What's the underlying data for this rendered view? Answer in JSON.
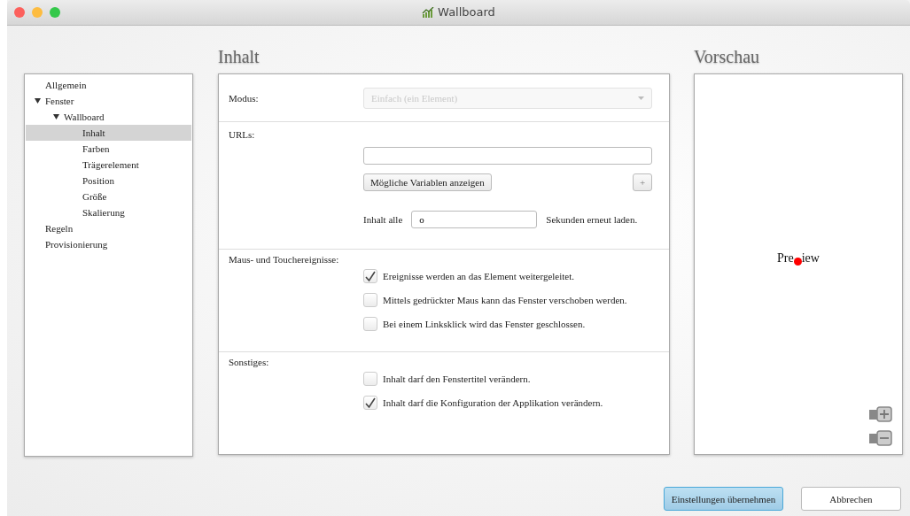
{
  "window": {
    "title": "Wallboard"
  },
  "headings": {
    "content": "Inhalt",
    "preview": "Vorschau"
  },
  "tree": [
    {
      "label": "Allgemein",
      "selected": false
    },
    {
      "label": "Fenster",
      "selected": false,
      "expanded": true,
      "children": [
        {
          "label": "Wallboard",
          "selected": false,
          "expanded": true,
          "children": [
            {
              "label": "Inhalt",
              "selected": true
            },
            {
              "label": "Farben",
              "selected": false
            },
            {
              "label": "Trägerelement",
              "selected": false
            },
            {
              "label": "Position",
              "selected": false
            },
            {
              "label": "Größe",
              "selected": false
            },
            {
              "label": "Skalierung",
              "selected": false
            }
          ]
        }
      ]
    },
    {
      "label": "Regeln",
      "selected": false
    },
    {
      "label": "Provisionierung",
      "selected": false
    }
  ],
  "mode": {
    "label": "Modus:",
    "value": "Einfach (ein Element)",
    "disabled": true
  },
  "urls": {
    "label": "URLs:",
    "variables_button": "Mögliche Variablen anzeigen",
    "add_button": "+",
    "reload_prefix": "Inhalt alle",
    "reload_value": "o",
    "reload_suffix": "Sekunden erneut laden."
  },
  "sections": [
    {
      "label": "Maus- und Touchereignisse:",
      "options": [
        {
          "label": "Ereignisse werden an das Element weitergeleitet.",
          "checked": true
        },
        {
          "label": "Mittels gedrückter Maus kann das Fenster verschoben werden.",
          "checked": false
        },
        {
          "label": "Bei einem Linksklick wird das Fenster geschlossen.",
          "checked": false
        }
      ]
    },
    {
      "label": "Sonstiges:",
      "options": [
        {
          "label": "Inhalt darf den Fenstertitel verändern.",
          "checked": false
        },
        {
          "label": "Inhalt darf die Konfiguration der Applikation verändern.",
          "checked": true
        }
      ]
    }
  ],
  "preview": {
    "text_before": "Pre",
    "text_after": "iew"
  },
  "buttons": [
    {
      "label": "Einstellungen übernehmen",
      "kind": "primary"
    },
    {
      "label": "Abbrechen",
      "kind": "secondary"
    }
  ]
}
